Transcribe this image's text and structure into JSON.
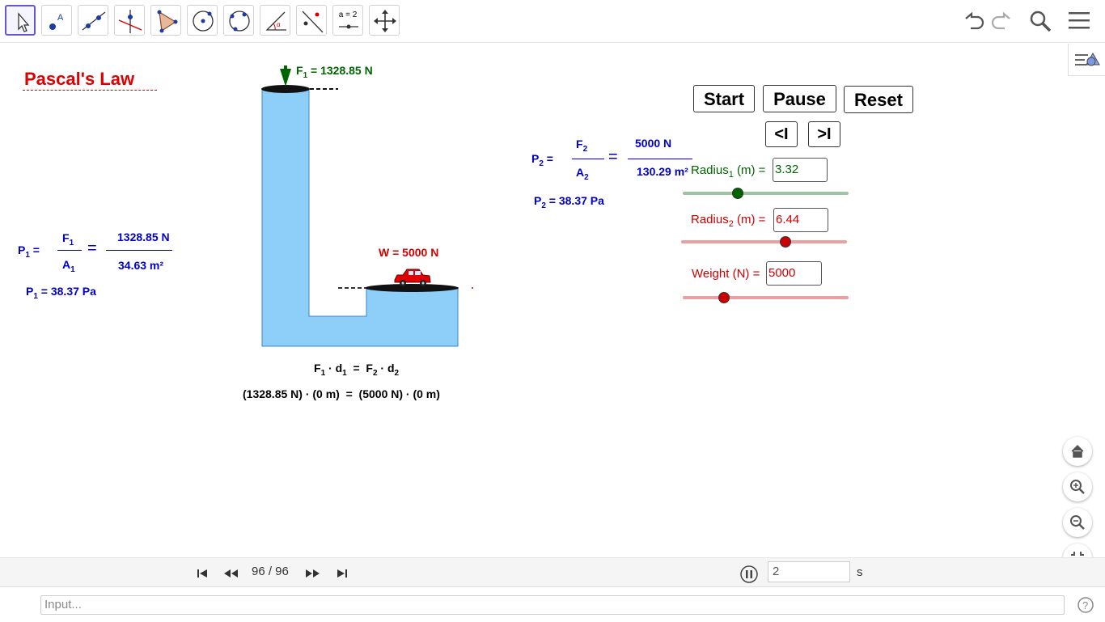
{
  "toolbar": {
    "tools": [
      "move",
      "point",
      "line",
      "perpendicular-line",
      "polygon",
      "circle-center-point",
      "circle-three-points",
      "angle",
      "reflect",
      "slider",
      "move-graphics-view"
    ],
    "slider_tool_label": "a = 2",
    "right_icons": [
      "undo",
      "redo",
      "search",
      "menu"
    ]
  },
  "title": "Pascal's  Law",
  "force_label": {
    "prefix": "F",
    "sub": "1",
    "suffix": " = 1328.85 N"
  },
  "weight_label": "W = 5000 N",
  "left_eq": {
    "p": "P",
    "p_sub": "1",
    "eq": " =",
    "num": "F",
    "num_sub": "1",
    "den": "A",
    "den_sub": "1",
    "equals": "=",
    "num_val": "1328.85  N",
    "den_val": "34.63  m²",
    "result_prefix": "P",
    "result_sub": "1",
    "result_suffix": " = 38.37 Pa"
  },
  "right_eq": {
    "p": "P",
    "p_sub": "2",
    "eq": " =",
    "num": "F",
    "num_sub": "2",
    "den": "A",
    "den_sub": "2",
    "equals": "=",
    "num_val": "5000  N",
    "den_val": "130.29  m²",
    "result_prefix": "P",
    "result_sub": "2",
    "result_suffix": " =  38.37 Pa"
  },
  "work_eq": {
    "f1": "F",
    "f1_sub": "1",
    "d1": " · d",
    "d1_sub": "1",
    "mid": "  =  ",
    "f2": "F",
    "f2_sub": "2",
    "d2": " · d",
    "d2_sub": "2",
    "line2": "(1328.85 N) · (0 m)  =  (5000 N) · (0 m)"
  },
  "buttons": {
    "start": "Start",
    "pause": "Pause",
    "reset": "Reset",
    "step_back": "<I",
    "step_forward": ">I"
  },
  "sliders": [
    {
      "label": "Radius",
      "sub": "1",
      "label_suffix": " (m) =",
      "value": "3.32",
      "color": "#006400",
      "track": "#9ec59e",
      "level": 0.33
    },
    {
      "label": "Radius",
      "sub": "2",
      "label_suffix": " (m) =",
      "value": "6.44",
      "color": "#cc0000",
      "track": "#e8a0a0",
      "level": 0.63
    },
    {
      "label": "Weight (N) =",
      "sub": "",
      "label_suffix": "",
      "value": "5000",
      "color": "#cc0000",
      "track": "#e8a0a0",
      "level": 0.25
    }
  ],
  "animation": {
    "frame": "96 / 96",
    "speed_value": "2",
    "unit": "s"
  },
  "input": {
    "placeholder": "Input..."
  },
  "colors": {
    "fluid": "#8ecffa",
    "fluid_border": "#3a86c8",
    "accent": "#6557d2",
    "title_red": "#e00000",
    "blue_text": "#0000cc"
  }
}
